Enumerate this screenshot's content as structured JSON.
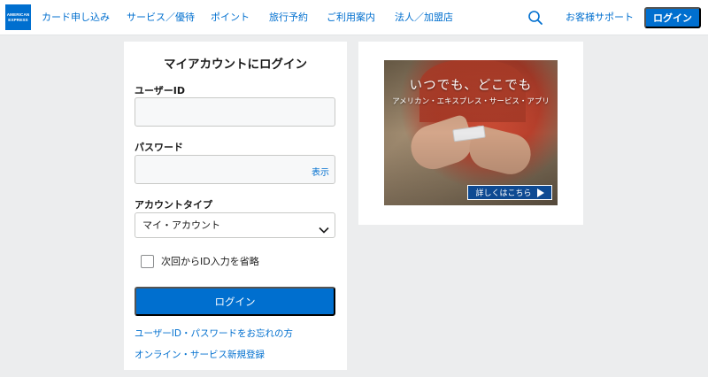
{
  "logo": {
    "line1": "AMERICAN",
    "line2": "EXPRESS"
  },
  "nav": {
    "items": [
      {
        "label": "カード申し込み"
      },
      {
        "label": "サービス／優待"
      },
      {
        "label": "ポイント"
      },
      {
        "label": "旅行予約"
      },
      {
        "label": "ご利用案内"
      },
      {
        "label": "法人／加盟店"
      }
    ],
    "support_label": "お客様サポート",
    "login_label": "ログイン"
  },
  "login_form": {
    "title": "マイアカウントにログイン",
    "user_id_label": "ユーザーID",
    "user_id_value": "",
    "password_label": "パスワード",
    "password_value": "",
    "show_toggle": "表示",
    "account_type_label": "アカウントタイプ",
    "account_type_selected": "マイ・アカウント",
    "remember_label": "次回からID入力を省略",
    "remember_checked": false,
    "submit_label": "ログイン",
    "forgot_link": "ユーザーID・パスワードをお忘れの方",
    "register_link": "オンライン・サービス新規登録"
  },
  "promo": {
    "headline": "いつでも、どこでも",
    "subtitle": "アメリカン・エキスプレス・サービス・アプリ",
    "cta_label": "詳しくはこちら"
  },
  "colors": {
    "brand": "#006fcf",
    "page_bg": "#ecedee",
    "cta_bg": "#0e4a92"
  },
  "icons": {
    "search": "search-icon",
    "chevron": "chevron-down-icon",
    "cta_arrow": "play-arrow-icon"
  }
}
